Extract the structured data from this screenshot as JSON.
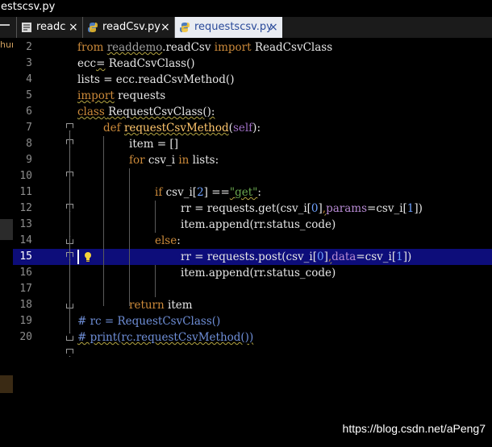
{
  "titlebar": {
    "text": "estscsv.py"
  },
  "tabs": [
    {
      "label": "readc",
      "close": "×",
      "active": false
    },
    {
      "label": "readCsv.py",
      "close": "×",
      "active": false
    },
    {
      "label": "requestscsv.py",
      "close": "×",
      "active": true
    }
  ],
  "side": {
    "text": "hun"
  },
  "lines": [
    {
      "n": "2"
    },
    {
      "n": "3"
    },
    {
      "n": "4"
    },
    {
      "n": "5"
    },
    {
      "n": "6"
    },
    {
      "n": "7"
    },
    {
      "n": "8"
    },
    {
      "n": "9"
    },
    {
      "n": "10"
    },
    {
      "n": "11"
    },
    {
      "n": "12"
    },
    {
      "n": "13"
    },
    {
      "n": "14"
    },
    {
      "n": "15"
    },
    {
      "n": "16"
    },
    {
      "n": "17"
    },
    {
      "n": "18"
    },
    {
      "n": "19"
    },
    {
      "n": "20"
    }
  ],
  "code": {
    "l2": {
      "k1": "from",
      "t1": " ",
      "m": "readdemo",
      "t2": ".readCsv ",
      "k2": "import",
      "t3": " ReadCsvClass"
    },
    "l3": {
      "a": "ecc",
      "b": "=",
      "c": " ReadCsvClass()"
    },
    "l4": {
      "t": "lists = ecc.readCsvMethod()"
    },
    "l5": {
      "k": "import",
      "t": " requests"
    },
    "l6": {
      "k": "class",
      "t": " ",
      "n": "RequestCsvClass",
      "e": "():"
    },
    "l7": {
      "k": "def",
      "t": " ",
      "f": "requestCsvMethod",
      "o": "(",
      "s": "self",
      "c": "):"
    },
    "l8": {
      "t": "item = []"
    },
    "l9": {
      "k": "for",
      "a": " csv_i ",
      "k2": "in",
      "b": " lists:"
    },
    "l11": {
      "k": "if",
      "a": " csv_i[",
      "n": "2",
      "b": "] ==",
      "s": "\"get\"",
      "c": ":"
    },
    "l12": {
      "a": "rr = requests.get(csv_i[",
      "n1": "0",
      "b": "]",
      "c": ",",
      "p": "params",
      "d": "=csv_i[",
      "n2": "1",
      "e": "])"
    },
    "l13": {
      "t": "item.append(rr.status_code)"
    },
    "l14": {
      "k": "else",
      "t": ":"
    },
    "l15": {
      "a": "rr = requests.post(csv_i[",
      "n1": "0",
      "b": "]",
      "c": ",",
      "p": "data",
      "d": "=csv_i[",
      "n2": "1",
      "e": "])"
    },
    "l16": {
      "t": "item.append(rr.status_code)"
    },
    "l18": {
      "k": "return",
      "t": " item"
    },
    "l19": {
      "t": "# rc = RequestCsvClass()"
    },
    "l20": {
      "t": "# print(rc.requestCsvMethod())"
    }
  },
  "watermark": {
    "text": "https://blog.csdn.net/aPeng7"
  },
  "colors": {
    "background": "#000000",
    "current_line": "#0d0d7a",
    "keyword": "#cc8a3a",
    "function_name": "#ffc66d",
    "number": "#6fa2ff",
    "string": "#6aa84f",
    "parameter": "#b88bd4",
    "active_tab": "#e9ecf2"
  },
  "icons": {
    "tab_file": "python-file-icon",
    "fold": "fold-marker-icon",
    "intention": "lightbulb-icon"
  }
}
